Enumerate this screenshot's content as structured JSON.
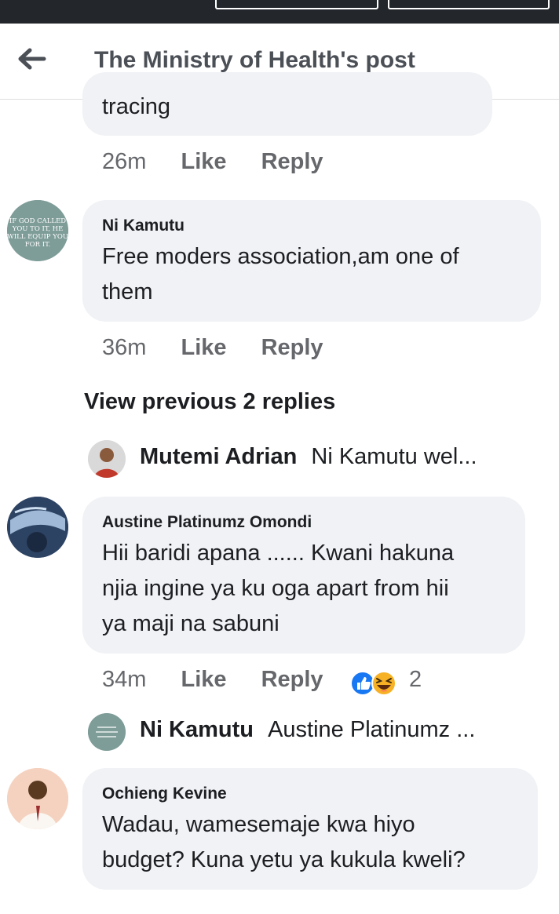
{
  "header": {
    "title": "The Ministry of Health's post"
  },
  "comments": [
    {
      "text": "tracing",
      "time": "26m",
      "like": "Like",
      "reply": "Reply"
    },
    {
      "author": "Ni Kamutu",
      "avatar_text": "IF GOD CALLED YOU TO IT, HE WILL EQUIP YOU FOR IT.",
      "line1": "Free moders association,am one of",
      "line2": "them",
      "time": "36m",
      "like": "Like",
      "reply": "Reply"
    },
    {
      "author": "Austine Platinumz Omondi",
      "line1": "Hii baridi apana ...... Kwani hakuna",
      "line2": "njia ingine ya ku oga apart from hii",
      "line3": "ya maji na sabuni",
      "time": "34m",
      "like": "Like",
      "reply": "Reply",
      "reaction_count": "2"
    },
    {
      "author": "Ochieng Kevine",
      "line1": "Wadau, wamesemaje kwa hiyo",
      "line2": "budget? Kuna yetu ya kukula kweli?"
    }
  ],
  "view_previous": "View previous 2 replies",
  "reply_previews": [
    {
      "name": "Mutemi Adrian",
      "snippet": "Ni Kamutu wel..."
    },
    {
      "name": "Ni Kamutu",
      "snippet": "Austine Platinumz ..."
    }
  ],
  "colors": {
    "accent": "#1877f2",
    "bubble": "#f0f2f5",
    "meta": "#65676b"
  }
}
